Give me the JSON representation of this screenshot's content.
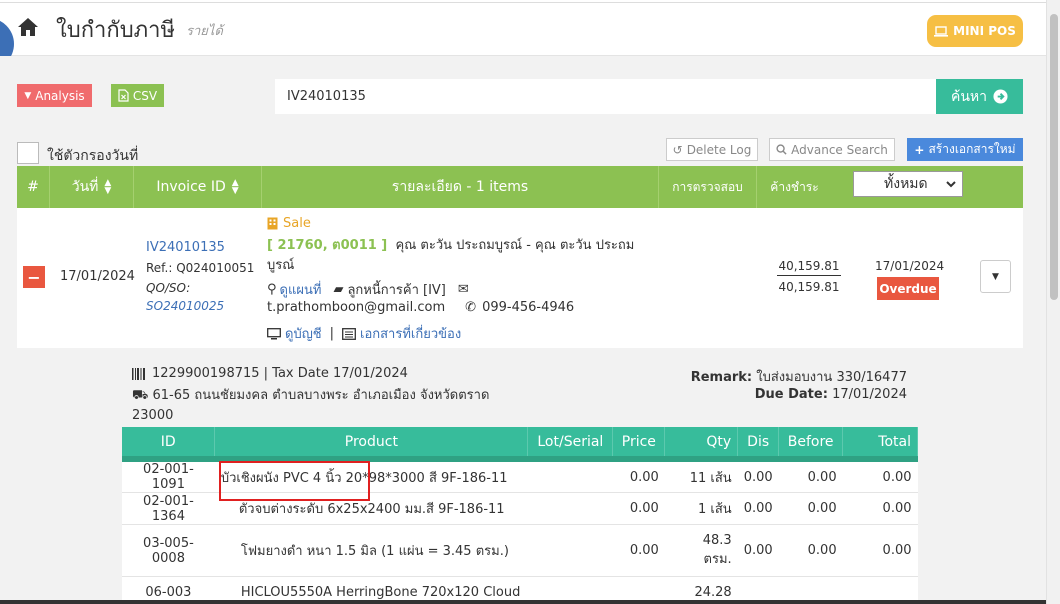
{
  "header": {
    "title": "ใบกำกับภาษี",
    "subtitle": "รายได้",
    "mini_pos_label": "MINI POS"
  },
  "toolbar": {
    "analysis_label": "Analysis",
    "csv_label": "CSV",
    "search_value": "IV24010135",
    "search_button_label": "ค้นหา",
    "date_filter_label": "ใช้ตัวกรองวันที่",
    "delete_log_label": "Delete Log",
    "advance_search_label": "Advance Search",
    "new_doc_label": "สร้างเอกสารใหม่"
  },
  "table_header": {
    "hash": "#",
    "date": "วันที่",
    "invoice_id": "Invoice ID",
    "details": "รายละเอียด - 1 items",
    "check": "การตรวจสอบ",
    "outstanding": "ค้างชำระ",
    "filter_selected": "ทั้งหมด"
  },
  "invoice": {
    "date": "17/01/2024",
    "id": "IV24010135",
    "ref": "Ref.: Q024010051",
    "qo_so_label": "QO/SO:",
    "so_link": "SO24010025",
    "type": "Sale",
    "customer_code": "[ 21760, ต0011 ]",
    "customer_name": "คุณ ตะวัน ประถมบูรณ์ - คุณ ตะวัน ประถมบูรณ์",
    "map_link": "ดูแผนที่",
    "account_type": "ลูกหนี้การค้า [IV]",
    "email": "t.prathomboon@gmail.com",
    "phone": "099-456-4946",
    "view_account_link": "ดูบัญชี",
    "related_docs_link": "เอกสารที่เกี่ยวข้อง",
    "amount_total": "40,159.81",
    "amount_outstanding": "40,159.81",
    "due_date": "17/01/2024",
    "status": "Overdue"
  },
  "detail": {
    "tax_line": "1229900198715 | Tax Date 17/01/2024",
    "address": "61-65 ถนนชัยมงคล ตำบลบางพระ อำเภอเมือง จังหวัดตราด 23000",
    "remark_label": "Remark:",
    "remark_value": "ใบส่งมอบงาน 330/16477",
    "due_label": "Due Date:",
    "due_value": "17/01/2024"
  },
  "products": {
    "columns": [
      "ID",
      "Product",
      "Lot/Serial",
      "Price",
      "Qty",
      "Dis",
      "Before",
      "Total"
    ],
    "rows": [
      {
        "id": "02-001-1091",
        "product": "บัวเชิงผนัง PVC 4 นิ้ว 20*98*3000 สี 9F-186-11",
        "lot": "",
        "price": "0.00",
        "qty": "11 เส้น",
        "dis": "0.00",
        "before": "0.00",
        "total": "0.00"
      },
      {
        "id": "02-001-1364",
        "product": "ตัวจบต่างระดับ 6x25x2400 มม.สี 9F-186-11",
        "lot": "",
        "price": "0.00",
        "qty": "1 เส้น",
        "dis": "0.00",
        "before": "0.00",
        "total": "0.00"
      },
      {
        "id": "03-005-0008",
        "product": "โฟมยางดำ หนา 1.5 มิล (1 แผ่น = 3.45 ตรม.)",
        "lot": "",
        "price": "0.00",
        "qty": "48.3 ตรม.",
        "dis": "0.00",
        "before": "0.00",
        "total": "0.00"
      },
      {
        "id": "06-003",
        "product": "HICLOU5550A HerringBone 720x120 Cloud",
        "lot": "",
        "price": "",
        "qty": "24.28",
        "dis": "",
        "before": "",
        "total": ""
      }
    ]
  }
}
